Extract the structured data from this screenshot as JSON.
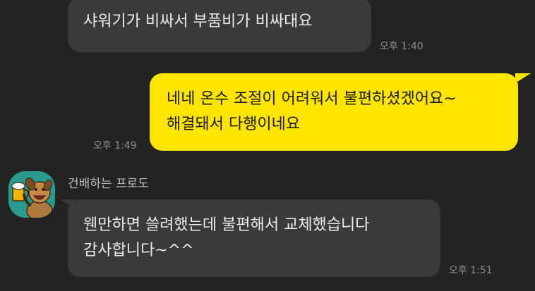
{
  "messages": [
    {
      "direction": "incoming",
      "text": "샤워기가 비싸서 부품비가 비싸대요",
      "time": "오후 1:40"
    },
    {
      "direction": "outgoing",
      "text": "네네 온수 조절이 어려워서 불편하셨겠어요~\n해결돼서 다행이네요",
      "time": "오후 1:49"
    },
    {
      "direction": "incoming",
      "sender": "건배하는 프로도",
      "avatar_icon": "frodo-cheers-icon",
      "text": "웬만하면 쓸려했는데 불편해서 교체했습니다\n감사합니다~^^",
      "time": "오후 1:51"
    }
  ],
  "colors": {
    "background": "#232323",
    "incoming_bubble": "#3a3a3c",
    "outgoing_bubble": "#fee500",
    "timestamp": "#8e8e8e",
    "avatar_bg": "#2a9a8e"
  }
}
